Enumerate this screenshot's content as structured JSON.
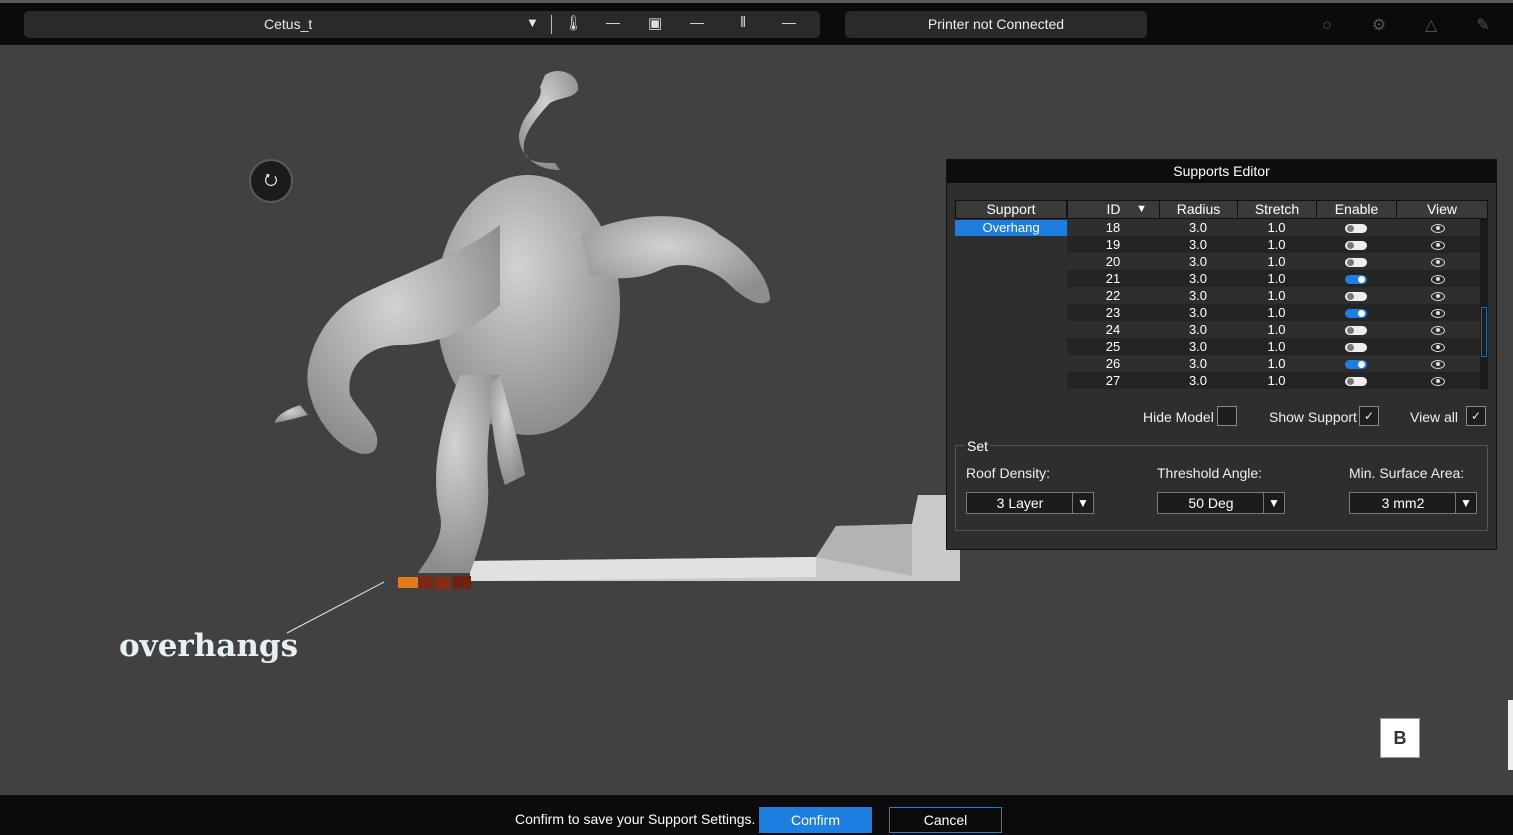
{
  "topbar": {
    "printer_name": "Cetus_t",
    "dropdown_glyph": "▼",
    "nozzle_icon": "nozzle-temp-icon",
    "nozzle_value": "—",
    "bed_icon": "bed-temp-icon",
    "bed_value": "—",
    "filament_icon": "filament-icon",
    "filament_value": "—",
    "status": "Printer not Connected",
    "icons": [
      "camera-icon",
      "gear-icon",
      "shirt-icon",
      "edit-icon"
    ]
  },
  "viewport": {
    "annotation": "overhangs",
    "b_button": "B"
  },
  "supports_editor": {
    "title": "Supports Editor",
    "support_header": "Support",
    "support_items": [
      "Overhang"
    ],
    "columns": [
      "ID",
      "Radius",
      "Stretch",
      "Enable",
      "View"
    ],
    "sort_glyph": "▼",
    "rows": [
      {
        "id": "18",
        "radius": "3.0",
        "stretch": "1.0",
        "enabled": false
      },
      {
        "id": "19",
        "radius": "3.0",
        "stretch": "1.0",
        "enabled": false
      },
      {
        "id": "20",
        "radius": "3.0",
        "stretch": "1.0",
        "enabled": false
      },
      {
        "id": "21",
        "radius": "3.0",
        "stretch": "1.0",
        "enabled": true
      },
      {
        "id": "22",
        "radius": "3.0",
        "stretch": "1.0",
        "enabled": false
      },
      {
        "id": "23",
        "radius": "3.0",
        "stretch": "1.0",
        "enabled": true
      },
      {
        "id": "24",
        "radius": "3.0",
        "stretch": "1.0",
        "enabled": false
      },
      {
        "id": "25",
        "radius": "3.0",
        "stretch": "1.0",
        "enabled": false
      },
      {
        "id": "26",
        "radius": "3.0",
        "stretch": "1.0",
        "enabled": true
      },
      {
        "id": "27",
        "radius": "3.0",
        "stretch": "1.0",
        "enabled": false
      }
    ],
    "hide_model": {
      "label": "Hide Model",
      "checked": false
    },
    "show_support": {
      "label": "Show Support",
      "checked": true
    },
    "view_all": {
      "label": "View all",
      "checked": true
    },
    "check_glyph": "✓",
    "set": {
      "legend": "Set",
      "roof_density": {
        "label": "Roof Density:",
        "value": "3 Layer"
      },
      "threshold_angle": {
        "label": "Threshold Angle:",
        "value": "50 Deg"
      },
      "min_surface_area": {
        "label": "Min. Surface Area:",
        "value": "3 mm2"
      }
    }
  },
  "footer": {
    "message": "Confirm to save your Support Settings.",
    "confirm": "Confirm",
    "cancel": "Cancel"
  },
  "colors": {
    "accent": "#1c7fe0",
    "background": "#414141",
    "bar": "#0b0b0b"
  }
}
